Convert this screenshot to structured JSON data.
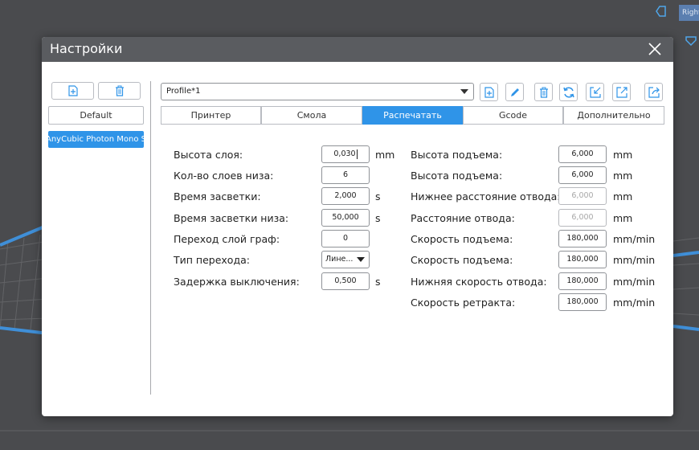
{
  "viewport": {
    "view_label": "Right"
  },
  "dialog": {
    "title": "Настройки",
    "left_panel": {
      "default_button": "Default",
      "printer_item": "AnyCubic Photon Mono SE"
    },
    "profile": {
      "selected": "Profile*1"
    },
    "tabs": [
      {
        "label": "Принтер",
        "active": false
      },
      {
        "label": "Смола",
        "active": false
      },
      {
        "label": "Распечатать",
        "active": true
      },
      {
        "label": "Gcode",
        "active": false
      },
      {
        "label": "Дополнительно",
        "active": false
      }
    ],
    "left_fields": [
      {
        "label": "Высота слоя:",
        "value": "0,030",
        "unit": "mm"
      },
      {
        "label": "Кол-во слоев низа:",
        "value": "6",
        "unit": ""
      },
      {
        "label": "Время засветки:",
        "value": "2,000",
        "unit": "s"
      },
      {
        "label": "Время засветки низа:",
        "value": "50,000",
        "unit": "s"
      },
      {
        "label": "Переход слой граф:",
        "value": "0",
        "unit": ""
      },
      {
        "label": "Тип перехода:",
        "value": "Лине...",
        "unit": ""
      },
      {
        "label": "Задержка выключения:",
        "value": "0,500",
        "unit": "s"
      }
    ],
    "right_fields": [
      {
        "label": "Высота подъема:",
        "value": "6,000",
        "unit": "mm"
      },
      {
        "label": "Высота подъема:",
        "value": "6,000",
        "unit": "mm"
      },
      {
        "label": "Нижнее расстояние отвода:",
        "value": "6,000",
        "unit": "mm"
      },
      {
        "label": "Расстояние отвода:",
        "value": "6,000",
        "unit": "mm"
      },
      {
        "label": "Скорость подъема:",
        "value": "180,000",
        "unit": "mm/min"
      },
      {
        "label": "Скорость подъема:",
        "value": "180,000",
        "unit": "mm/min"
      },
      {
        "label": "Нижняя скорость отвода:",
        "value": "180,000",
        "unit": "mm/min"
      },
      {
        "label": "Скорость ретракта:",
        "value": "180,000",
        "unit": "mm/min"
      }
    ],
    "colors": {
      "accent": "#2f94e8",
      "titlebar": "#5a5c60",
      "background": "#4a4b4e"
    }
  }
}
